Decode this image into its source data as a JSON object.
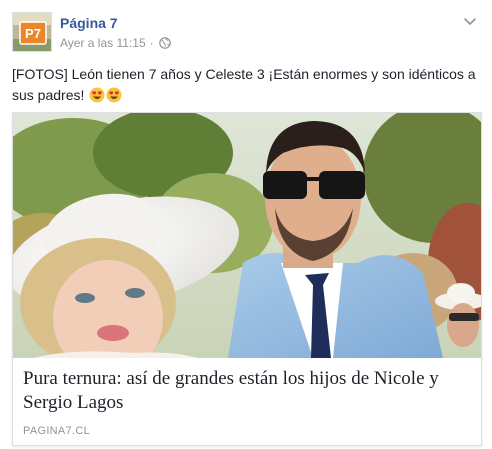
{
  "post": {
    "page_name": "Página 7",
    "avatar_text": "P7",
    "timestamp": "Ayer a las 11:15",
    "separator": "·",
    "privacy_icon": "globe-icon",
    "menu_icon": "chevron-down-icon",
    "text": "[FOTOS] León tienen 7 años y Celeste 3 ¡Están enormes y son idénticos a sus padres!",
    "emojis": [
      "heart-eyes-emoji",
      "heart-eyes-emoji"
    ]
  },
  "link": {
    "image_alt": "photo-of-couple",
    "title": "Pura ternura: así de grandes están los hijos de Nicole y Sergio Lagos",
    "domain": "PAGINA7.CL"
  },
  "colors": {
    "brand_blue": "#365899",
    "meta_gray": "#90949c",
    "text": "#1d2129",
    "border": "#dddfe2"
  }
}
